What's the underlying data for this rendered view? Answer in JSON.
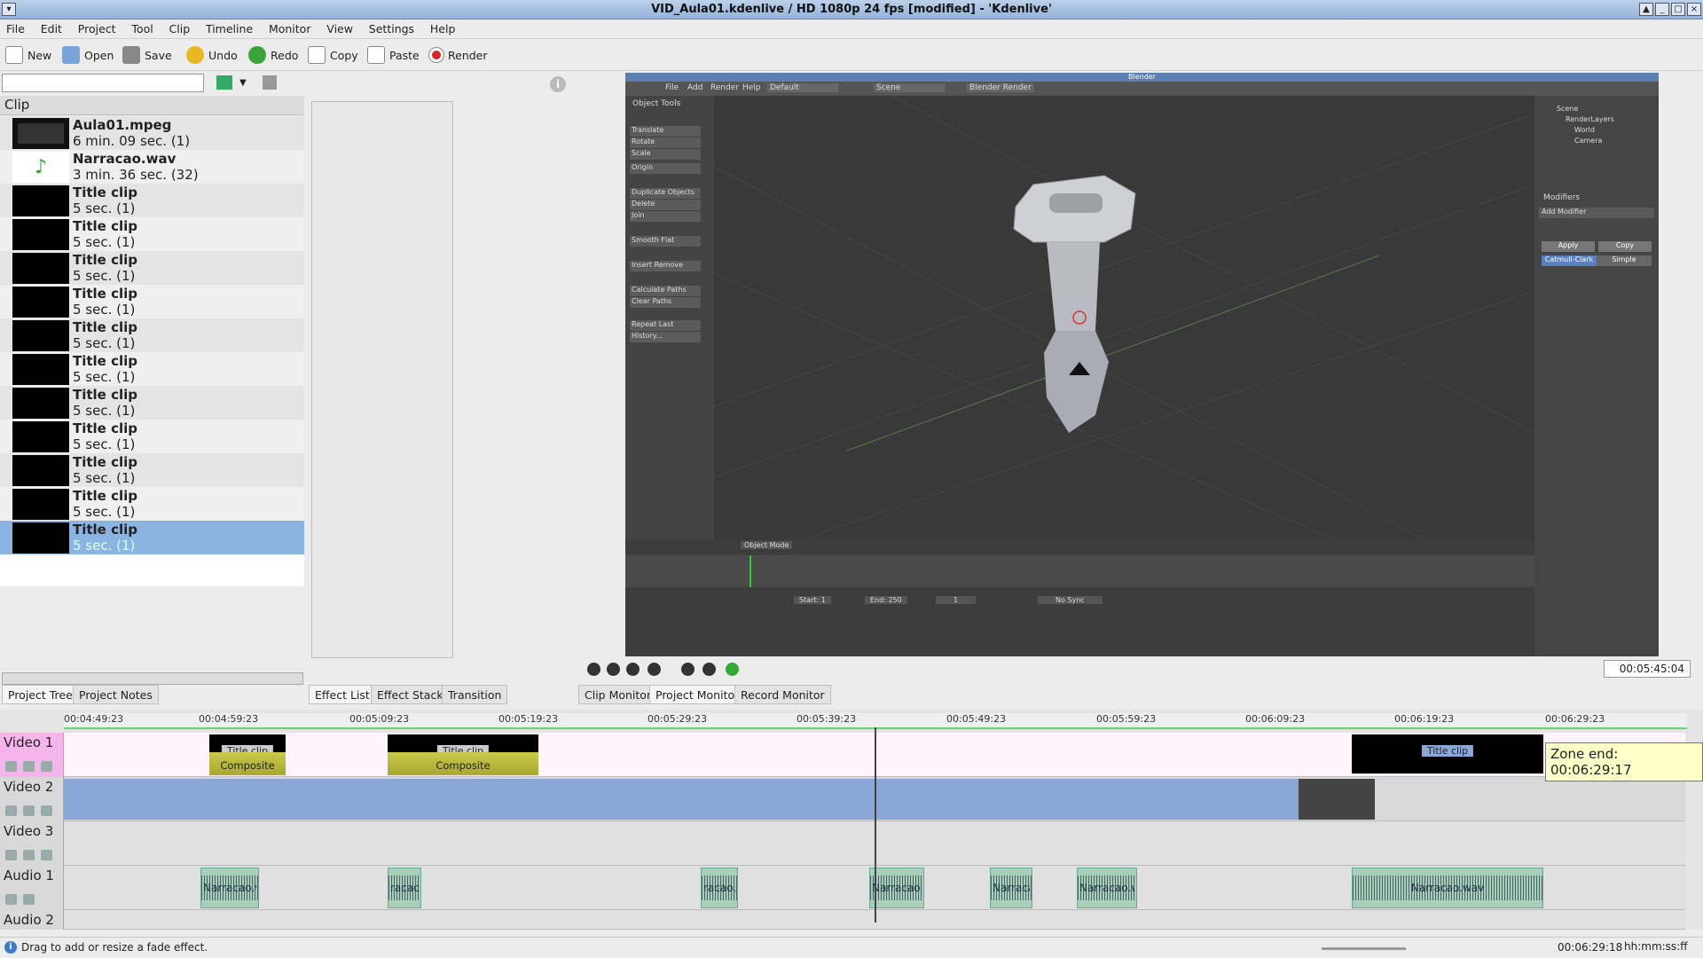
{
  "window": {
    "title": "VID_Aula01.kdenlive / HD 1080p 24 fps [modified] - 'Kdenlive'"
  },
  "menu": [
    "File",
    "Edit",
    "Project",
    "Tool",
    "Clip",
    "Timeline",
    "Monitor",
    "View",
    "Settings",
    "Help"
  ],
  "toolbar": {
    "new": "New",
    "open": "Open",
    "save": "Save",
    "undo": "Undo",
    "redo": "Redo",
    "copy": "Copy",
    "paste": "Paste",
    "render": "Render"
  },
  "project_tree": {
    "header": "Clip",
    "clips": [
      {
        "name": "Aula01.mpeg",
        "duration": "6 min. 09 sec. (1)"
      },
      {
        "name": "Narracao.wav",
        "duration": "3 min. 36 sec. (32)"
      },
      {
        "name": "Title clip",
        "duration": "5 sec. (1)"
      },
      {
        "name": "Title clip",
        "duration": "5 sec. (1)"
      },
      {
        "name": "Title clip",
        "duration": "5 sec. (1)"
      },
      {
        "name": "Title clip",
        "duration": "5 sec. (1)"
      },
      {
        "name": "Title clip",
        "duration": "5 sec. (1)"
      },
      {
        "name": "Title clip",
        "duration": "5 sec. (1)"
      },
      {
        "name": "Title clip",
        "duration": "5 sec. (1)"
      },
      {
        "name": "Title clip",
        "duration": "5 sec. (1)"
      },
      {
        "name": "Title clip",
        "duration": "5 sec. (1)"
      },
      {
        "name": "Title clip",
        "duration": "5 sec. (1)"
      },
      {
        "name": "Title clip",
        "duration": "5 sec. (1)"
      }
    ]
  },
  "tabs": {
    "left": [
      "Project Tree",
      "Project Notes"
    ],
    "middle": [
      "Effect List",
      "Effect Stack",
      "Transition"
    ],
    "monitor": [
      "Clip Monitor",
      "Project Monitor",
      "Record Monitor"
    ]
  },
  "blender": {
    "title": "Blender",
    "menu": [
      "File",
      "Add",
      "Render",
      "Help"
    ],
    "layout": "Default",
    "scene": "Scene",
    "engine": "Blender Render",
    "tools_header": "Object Tools",
    "tools": [
      "Translate",
      "Rotate",
      "Scale",
      "Origin",
      "Duplicate Objects",
      "Delete",
      "Join",
      "Smooth  Flat",
      "Insert  Remove",
      "Calculate Paths",
      "Clear Paths",
      "Repeat Last",
      "History..."
    ],
    "outliner": [
      "Scene",
      "RenderLayers",
      "World",
      "Camera"
    ],
    "modifiers": {
      "header": "Modifiers",
      "add": "Add Modifier",
      "apply": "Apply",
      "copy": "Copy",
      "catmull": "Catmull-Clark",
      "simple": "Simple"
    },
    "mode": "Object Mode",
    "timeline": {
      "start": "Start: 1",
      "end": "End: 250",
      "frame": "1",
      "sync": "No Sync"
    }
  },
  "monitor": {
    "timecode": "00:05:45:04"
  },
  "timeline": {
    "ruler": [
      "00:04:49:23",
      "00:04:59:23",
      "00:05:09:23",
      "00:05:19:23",
      "00:05:29:23",
      "00:05:39:23",
      "00:05:49:23",
      "00:05:59:23",
      "00:06:09:23",
      "00:06:19:23",
      "00:06:29:23"
    ],
    "tracks": [
      "Video 1",
      "Video 2",
      "Video 3",
      "Audio 1",
      "Audio 2"
    ],
    "title_label": "Title clip",
    "composite_label": "Composite",
    "audio_label": "Narracao.wav",
    "audio_frag": [
      "Narracao.wa",
      "racao.v",
      "racao.v",
      "Narracao.wa",
      "Narracao.w",
      "Narracao.wa",
      "Narracao.wav"
    ],
    "zone_tip": "Zone end: 00:06:29:17"
  },
  "status": {
    "message": "Drag to add or resize a fade effect.",
    "timecode": "00:06:29:18",
    "format": "hh:mm:ss:ff"
  }
}
